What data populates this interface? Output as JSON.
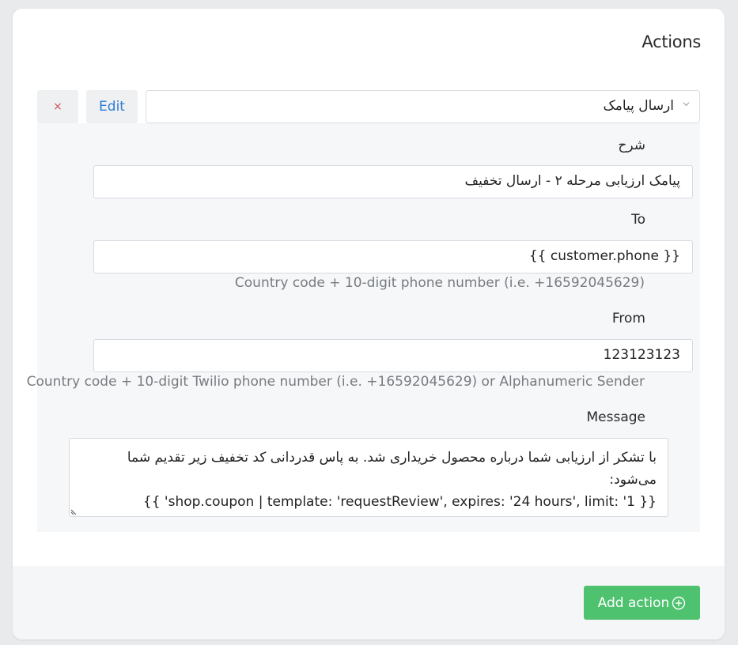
{
  "section": {
    "title": "Actions"
  },
  "action": {
    "delete_label": "×",
    "edit_label": "Edit",
    "type_selected": "ارسال پیامک",
    "fields": {
      "description": {
        "label": "شرح",
        "value": "پیامک ارزیابی مرحله ۲ - ارسال تخفیف"
      },
      "to": {
        "label": "To",
        "value": "{{ customer.phone }}",
        "help": "Country code + 10-digit phone number (i.e. +16592045629)"
      },
      "from": {
        "label": "From",
        "value": "123123123",
        "help": "Country code + 10-digit Twilio phone number (i.e. +16592045629) or Alphanumeric Sender"
      },
      "message": {
        "label": "Message",
        "line1": "با تشکر از ارزیابی شما درباره محصول خریداری شد. به پاس قدردانی کد تخفیف زیر تقدیم شما",
        "line2": "می‌شود:",
        "line3": "{{ 'shop.coupon | template: 'requestReview', expires: '24 hours', limit: '1 }}"
      }
    }
  },
  "footer": {
    "add_action_label": "Add action"
  },
  "colors": {
    "accent_green": "#4fc26f",
    "edit_blue": "#2f7bd6",
    "delete_red": "#d0505c"
  }
}
